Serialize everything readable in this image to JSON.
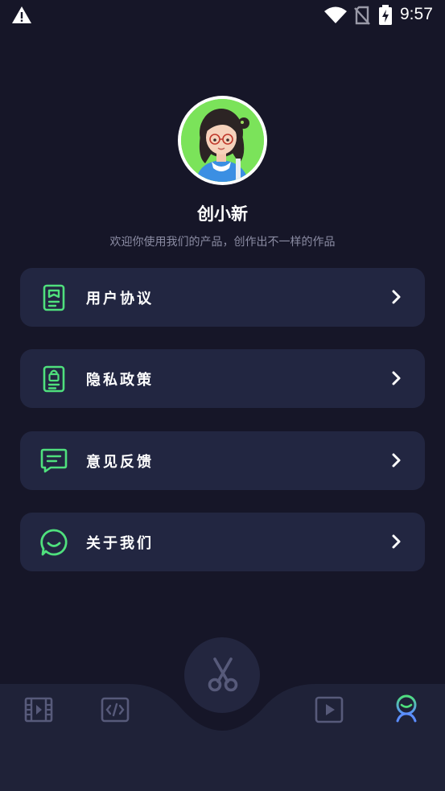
{
  "status_bar": {
    "time": "9:57",
    "icons": [
      "warning-icon",
      "wifi-icon",
      "no-sim-icon",
      "battery-charging-icon"
    ]
  },
  "profile": {
    "name": "创小新",
    "tagline": "欢迎你使用我们的产品，创作出不一样的作品"
  },
  "menu": {
    "items": [
      {
        "label": "用户协议",
        "icon": "user-agreement-icon"
      },
      {
        "label": "隐私政策",
        "icon": "privacy-lock-icon"
      },
      {
        "label": "意见反馈",
        "icon": "feedback-message-icon"
      },
      {
        "label": "关于我们",
        "icon": "about-chat-icon"
      }
    ]
  },
  "bottom_nav": {
    "tabs": [
      {
        "icon": "film-icon",
        "active": false
      },
      {
        "icon": "code-icon",
        "active": false
      },
      {
        "icon": "scissors-icon",
        "active": false,
        "center": true
      },
      {
        "icon": "play-icon",
        "active": false
      },
      {
        "icon": "profile-icon",
        "active": true
      }
    ]
  },
  "colors": {
    "background": "#161628",
    "card": "#222641",
    "accent_green": "#4fe07d",
    "accent_blue": "#5b8dff",
    "muted": "#8b8ca3",
    "nav_icon_inactive": "#575a7a"
  }
}
